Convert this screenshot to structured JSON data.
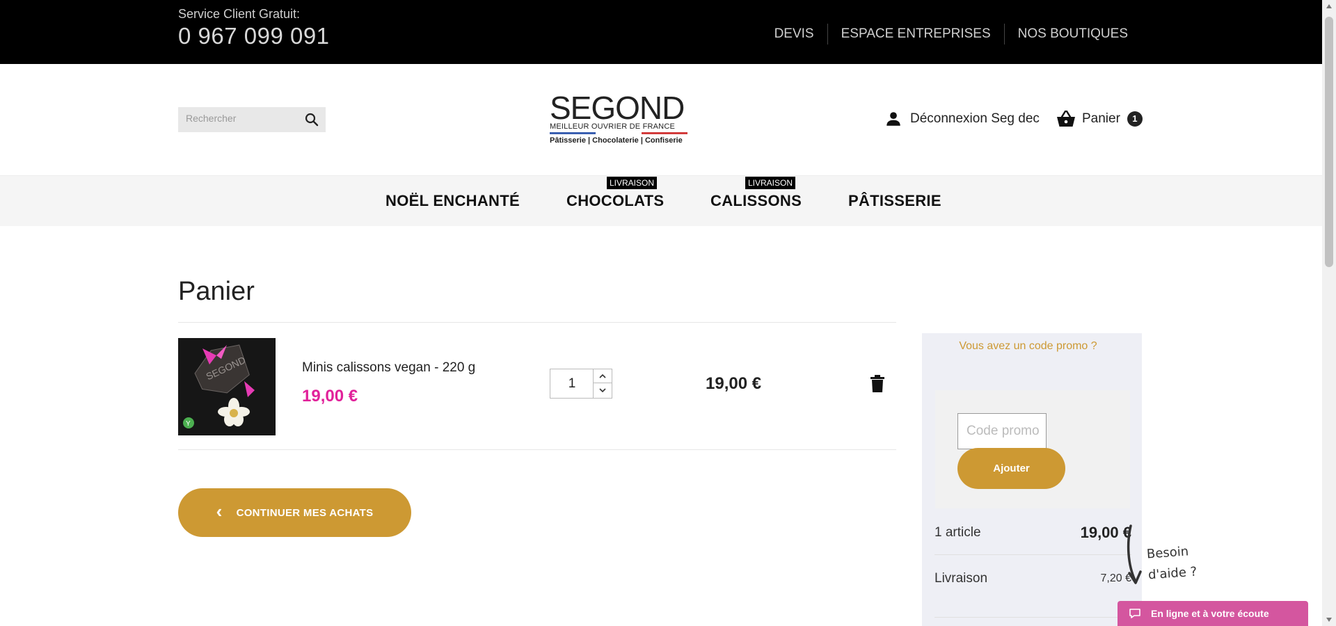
{
  "topbar": {
    "service_label": "Service Client Gratuit:",
    "phone": "0 967 099 091",
    "links": [
      "DEVIS",
      "ESPACE ENTREPRISES",
      "NOS BOUTIQUES"
    ]
  },
  "header": {
    "search_placeholder": "Rechercher",
    "logo": {
      "main": "SEGOND",
      "sub": "MEILLEUR OUVRIER DE FRANCE",
      "tagline": "Pâtisserie | Chocolaterie | Confiserie"
    },
    "account_label": "Déconnexion Seg dec",
    "cart_label": "Panier",
    "cart_count": "1"
  },
  "nav": {
    "items": [
      {
        "label": "NOËL ENCHANTÉ",
        "badge": ""
      },
      {
        "label": "CHOCOLATS",
        "badge": "LIVRAISON"
      },
      {
        "label": "CALISSONS",
        "badge": "LIVRAISON"
      },
      {
        "label": "PÂTISSERIE",
        "badge": ""
      }
    ]
  },
  "cart": {
    "title": "Panier",
    "items": [
      {
        "name": "Minis calissons vegan - 220 g",
        "unit_price": "19,00 €",
        "quantity": "1",
        "total": "19,00 €",
        "image_label": "Vegan"
      }
    ],
    "continue_label": "CONTINUER MES ACHATS"
  },
  "summary": {
    "promo_link": "Vous avez un code promo ?",
    "promo_placeholder": "Code promo",
    "promo_button": "Ajouter",
    "articles_label": "1 article",
    "articles_value": "19,00 €",
    "shipping_label": "Livraison",
    "shipping_value": "7,20 €"
  },
  "help": {
    "text_line1": "Besoin",
    "text_line2": "d'aide ?",
    "chat_label": "En ligne et à votre écoute"
  },
  "colors": {
    "accent_gold": "#cd9933",
    "price_pink": "#e1219a",
    "chat_pink": "#d4569f"
  }
}
